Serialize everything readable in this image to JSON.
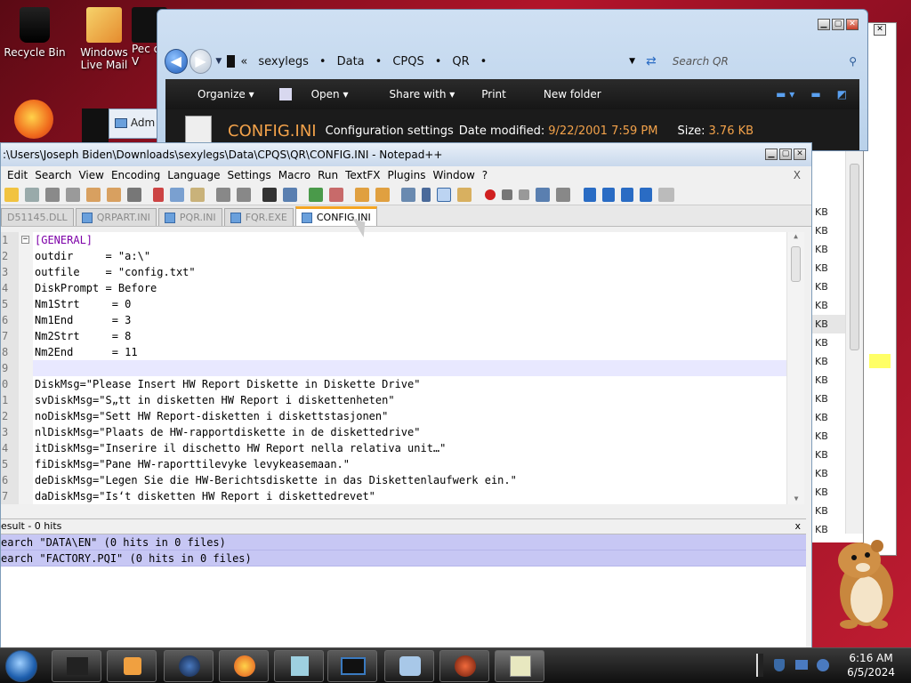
{
  "desktop": {
    "icons": [
      {
        "label": "Recycle Bin"
      },
      {
        "label": "Windows Live Mail"
      },
      {
        "label": "Pec of V"
      }
    ],
    "partial_window_label": "Adm"
  },
  "explorer": {
    "breadcrumb": [
      "sexylegs",
      "Data",
      "CPQS",
      "QR"
    ],
    "search_placeholder": "Search QR",
    "toolbar": [
      "Organize",
      "Open",
      "Share with",
      "Print",
      "New folder"
    ],
    "details": {
      "file_name": "CONFIG.INI",
      "file_type": "Configuration settings",
      "date_label": "Date modified:",
      "date_value": "9/22/2001 7:59 PM",
      "size_label": "Size:",
      "size_value": "3.76 KB"
    },
    "size_column": [
      "KB",
      "KB",
      "KB",
      "KB",
      "KB",
      "KB",
      "KB",
      "KB",
      "KB",
      "KB",
      "KB",
      "KB",
      "KB",
      "KB",
      "KB",
      "KB",
      "KB",
      "KB"
    ]
  },
  "notepad": {
    "title": ":\\Users\\Joseph Biden\\Downloads\\sexylegs\\Data\\CPQS\\QR\\CONFIG.INI - Notepad++",
    "menu": [
      "Edit",
      "Search",
      "View",
      "Encoding",
      "Language",
      "Settings",
      "Macro",
      "Run",
      "TextFX",
      "Plugins",
      "Window",
      "?"
    ],
    "menu_close": "X",
    "tabs": [
      "D51145.DLL",
      "QRPART.INI",
      "PQR.INI",
      "FQR.EXE",
      "CONFIG.INI"
    ],
    "active_tab": "CONFIG.INI",
    "lines": [
      {
        "n": "1",
        "text": "[GENERAL]"
      },
      {
        "n": "2",
        "text": "outdir     = \"a:\\\""
      },
      {
        "n": "3",
        "text": "outfile    = \"config.txt\""
      },
      {
        "n": "4",
        "text": "DiskPrompt = Before"
      },
      {
        "n": "5",
        "text": "Nm1Strt     = 0"
      },
      {
        "n": "6",
        "text": "Nm1End      = 3"
      },
      {
        "n": "7",
        "text": "Nm2Strt     = 8"
      },
      {
        "n": "8",
        "text": "Nm2End      = 11"
      },
      {
        "n": "9",
        "text": ""
      },
      {
        "n": "0",
        "text": "DiskMsg=\"Please Insert HW Report Diskette in Diskette Drive\""
      },
      {
        "n": "1",
        "text": "svDiskMsg=\"S„tt in disketten HW Report i diskettenheten\""
      },
      {
        "n": "2",
        "text": "noDiskMsg=\"Sett HW Report-disketten i diskettstasjonen\""
      },
      {
        "n": "3",
        "text": "nlDiskMsg=\"Plaats de HW-rapportdiskette in de diskettedrive\""
      },
      {
        "n": "4",
        "text": "itDiskMsg=\"Inserire il dischetto HW Report nella relativa unit…\""
      },
      {
        "n": "5",
        "text": "fiDiskMsg=\"Pane HW-raporttilevyke levykeasemaan.\""
      },
      {
        "n": "6",
        "text": "deDiskMsg=\"Legen Sie die HW-Berichtsdiskette in das Diskettenlaufwerk ein.\""
      },
      {
        "n": "7",
        "text": "daDiskMsg=\"Is‘t disketten HW Report i diskettedrevet\""
      }
    ],
    "result_title": "esult - 0 hits",
    "result_close": "x",
    "results": [
      "earch \"DATA\\EN\" (0 hits in 0 files)",
      "earch \"FACTORY.PQI\" (0 hits in 0 files)"
    ]
  },
  "taskbar": {
    "time": "6:16 AM",
    "date": "6/5/2024"
  }
}
